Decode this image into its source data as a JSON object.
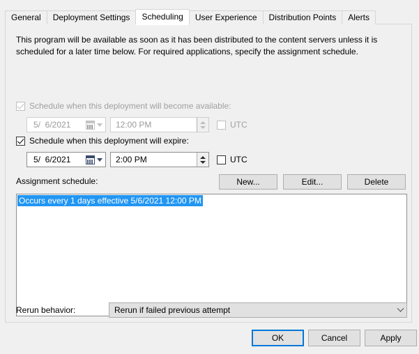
{
  "tabs": [
    {
      "label": "General",
      "selected": false
    },
    {
      "label": "Deployment Settings",
      "selected": false
    },
    {
      "label": "Scheduling",
      "selected": true
    },
    {
      "label": "User Experience",
      "selected": false
    },
    {
      "label": "Distribution Points",
      "selected": false
    },
    {
      "label": "Alerts",
      "selected": false
    }
  ],
  "panel": {
    "description": "This program will be available as soon as it has been distributed to the content servers unless it is scheduled for a later time below. For required applications, specify the assignment schedule.",
    "available": {
      "checkbox_label": "Schedule when this deployment will become available:",
      "checked": true,
      "enabled": false,
      "date_value": "5/  6/2021",
      "time_value": "12:00 PM",
      "utc_label": "UTC",
      "utc_checked": false,
      "calendar_icon": "calendar-icon",
      "dropdown_icon": "chevron-down-icon",
      "spinner_icon": "spinner-updown-icon"
    },
    "expire": {
      "checkbox_label": "Schedule when this deployment will expire:",
      "checked": true,
      "enabled": true,
      "date_value": "5/  6/2021",
      "time_value": "2:00 PM",
      "utc_label": "UTC",
      "utc_checked": false,
      "calendar_icon": "calendar-icon",
      "dropdown_icon": "chevron-down-icon",
      "spinner_icon": "spinner-updown-icon"
    },
    "assignment": {
      "label": "Assignment schedule:",
      "new_label": "New...",
      "edit_label": "Edit...",
      "delete_label": "Delete",
      "items": [
        {
          "text": "Occurs every 1 days effective 5/6/2021 12:00 PM",
          "selected": true
        }
      ],
      "selection_color": "#2196f3"
    },
    "rerun": {
      "label": "Rerun behavior:",
      "selected_value": "Rerun if failed previous attempt",
      "chevron_icon": "chevron-down-icon"
    }
  },
  "dialog_buttons": {
    "ok_label": "OK",
    "cancel_label": "Cancel",
    "apply_label": "Apply",
    "focus_color": "#0078d7"
  }
}
